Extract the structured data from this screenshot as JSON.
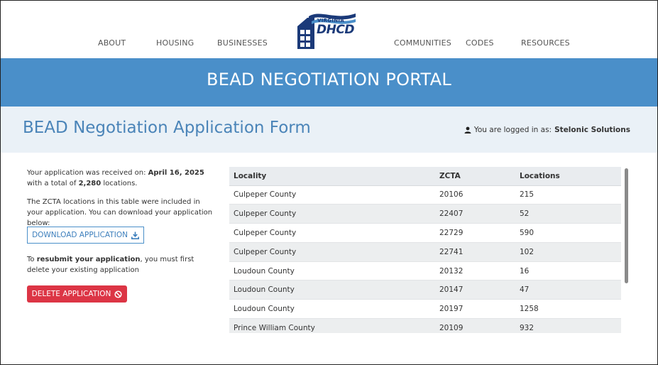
{
  "nav": {
    "about": "ABOUT",
    "housing": "HOUSING",
    "businesses": "BUSINESSES",
    "communities": "COMMUNITIES",
    "codes": "CODES",
    "resources": "RESOURCES",
    "logo_top": "VIRGINIA",
    "logo_main": "DHCD"
  },
  "banner": {
    "title": "BEAD NEGOTIATION PORTAL"
  },
  "header": {
    "form_title": "BEAD Negotiation Application Form",
    "login_prefix": "You are logged in as:",
    "login_user": "Stelonic Solutions"
  },
  "summary": {
    "received_prefix": "Your application was received on: ",
    "received_date": "April 16, 2025",
    "received_mid": " with a total of ",
    "total_locations": "2,280",
    "received_suffix": " locations.",
    "zcta_note": "The ZCTA locations in this table were included in your application. You can download your application below:",
    "download_label": "DOWNLOAD APPLICATION",
    "resubmit_prefix": "To ",
    "resubmit_bold": "resubmit your application",
    "resubmit_suffix": ", you must first delete your existing application",
    "delete_label": "DELETE APPLICATION"
  },
  "table": {
    "headers": [
      "Locality",
      "ZCTA",
      "Locations"
    ],
    "rows": [
      [
        "Culpeper County",
        "20106",
        "215"
      ],
      [
        "Culpeper County",
        "22407",
        "52"
      ],
      [
        "Culpeper County",
        "22729",
        "590"
      ],
      [
        "Culpeper County",
        "22741",
        "102"
      ],
      [
        "Loudoun County",
        "20132",
        "16"
      ],
      [
        "Loudoun County",
        "20147",
        "47"
      ],
      [
        "Loudoun County",
        "20197",
        "1258"
      ],
      [
        "Prince William County",
        "20109",
        "932"
      ]
    ]
  },
  "colors": {
    "banner": "#4a8fc9",
    "title_blue": "#4a84b8",
    "delete_red": "#dc3545",
    "logo_navy": "#1b3a79"
  },
  "icons": {
    "download": "download-icon",
    "delete": "ban-icon",
    "user": "user-icon"
  }
}
